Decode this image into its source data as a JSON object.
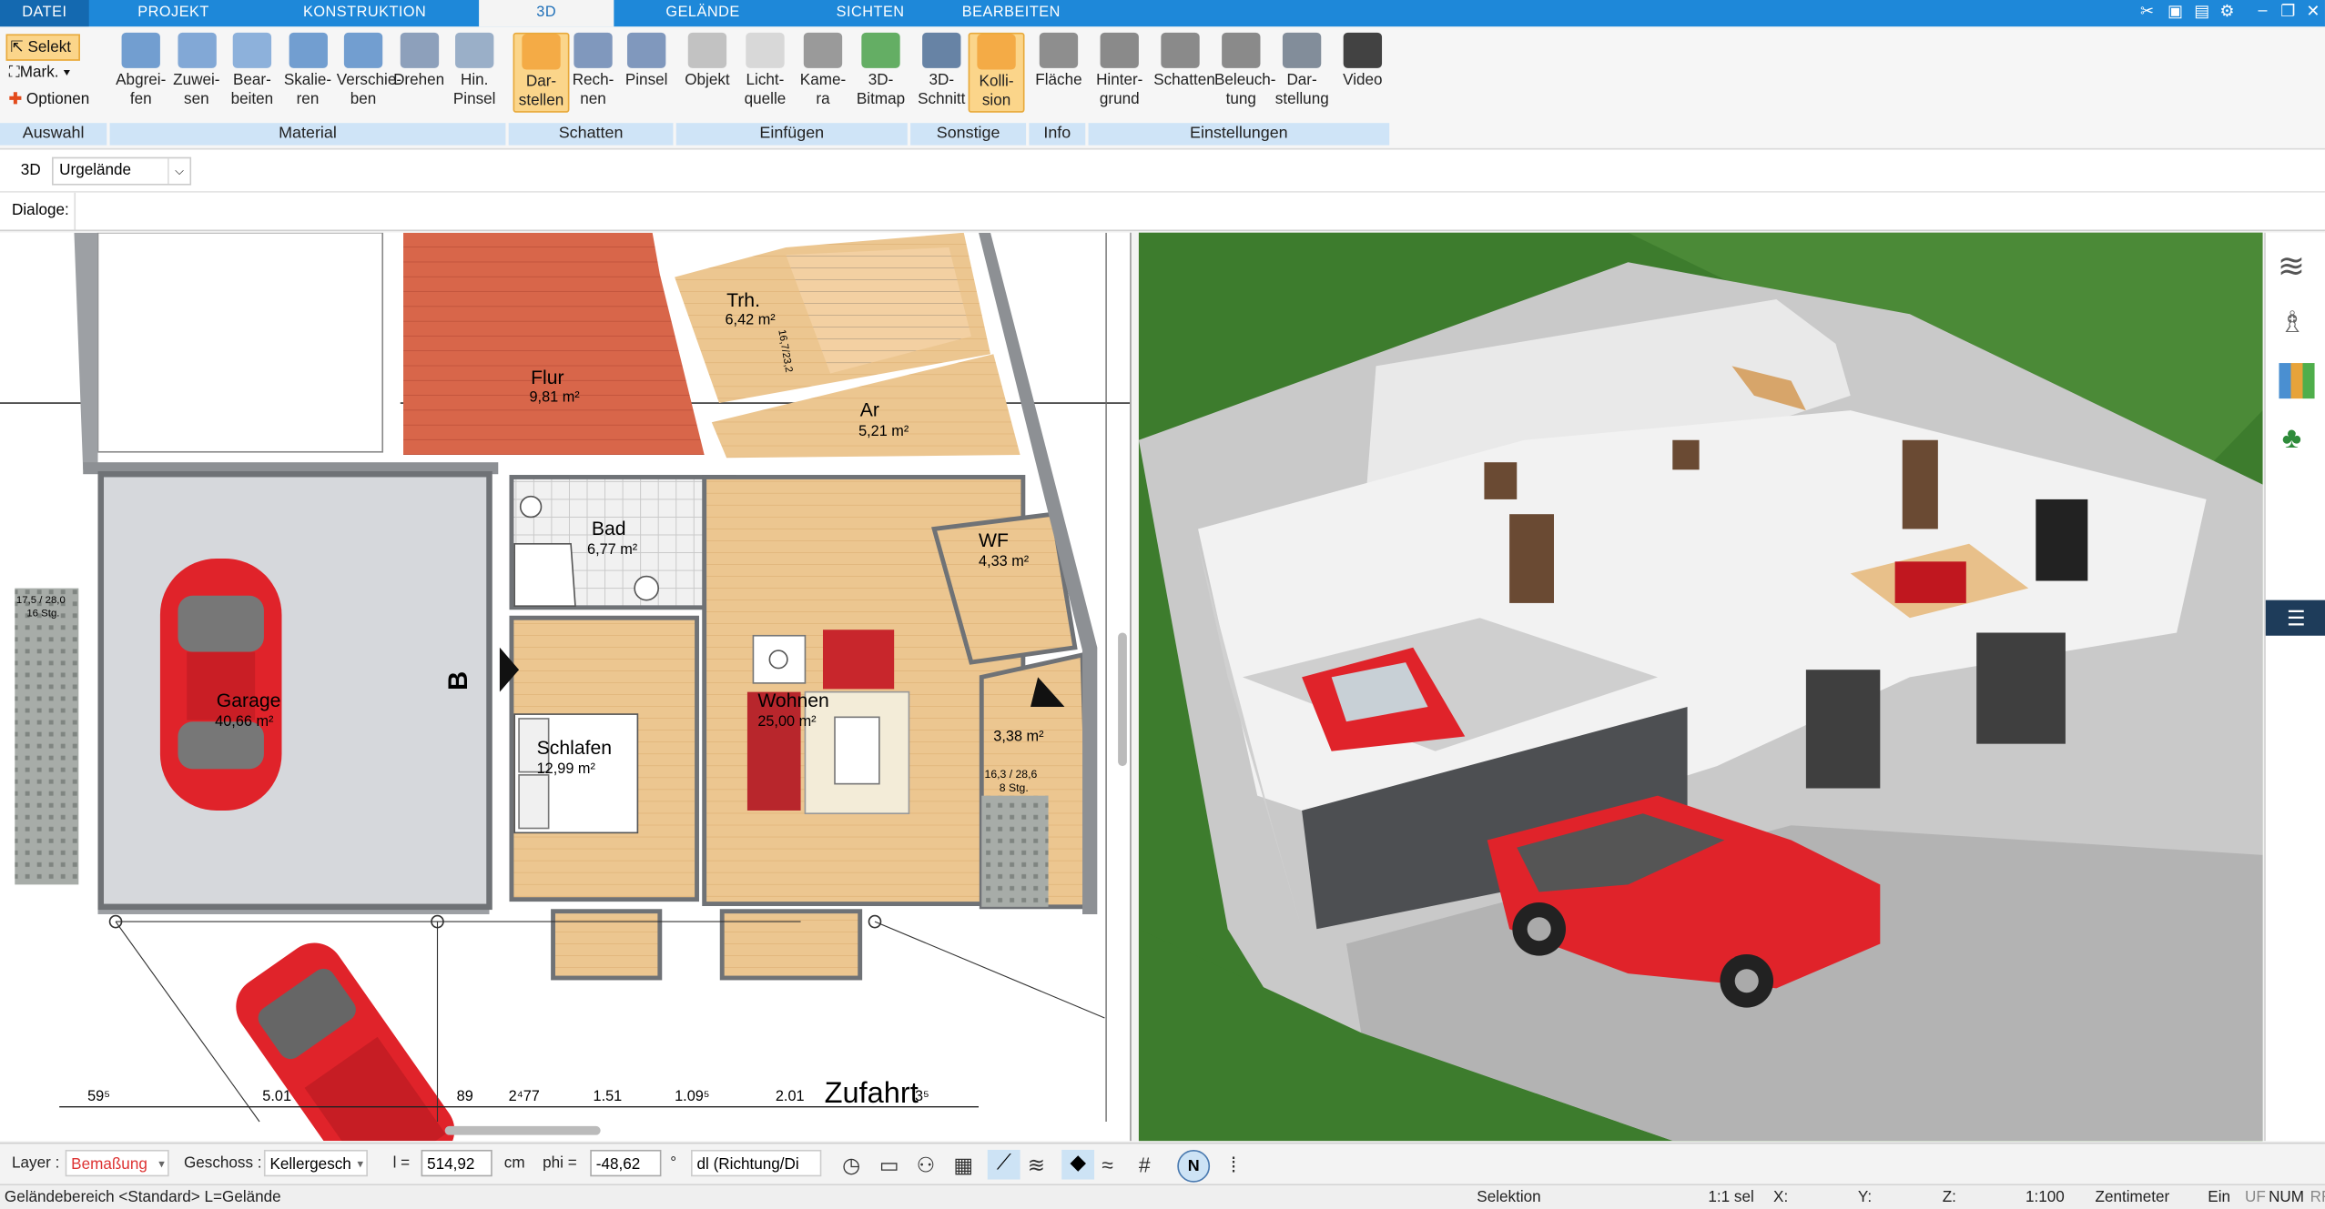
{
  "menu": {
    "tabs": [
      "DATEI",
      "PROJEKT",
      "KONSTRUKTION",
      "3D",
      "GELÄNDE",
      "SICHTEN",
      "BEARBEITEN"
    ],
    "active": "3D"
  },
  "ribbon": {
    "auswahl": {
      "selekt": "Selekt",
      "mark": "Mark.",
      "optionen": "Optionen",
      "label": "Auswahl"
    },
    "material": {
      "label": "Material",
      "buttons": [
        [
          "Abgrei-",
          "fen"
        ],
        [
          "Zuwei-",
          "sen"
        ],
        [
          "Bear-",
          "beiten"
        ],
        [
          "Skalie-",
          "ren"
        ],
        [
          "Verschie-",
          "ben"
        ],
        [
          "Drehen",
          ""
        ],
        [
          "Hin.",
          "Pinsel"
        ]
      ]
    },
    "schatten": {
      "label": "Schatten",
      "buttons": [
        [
          "Dar-",
          "stellen"
        ],
        [
          "Rech-",
          "nen"
        ],
        [
          "Pinsel",
          ""
        ]
      ]
    },
    "einfuegen": {
      "label": "Einfügen",
      "buttons": [
        [
          "Objekt",
          ""
        ],
        [
          "Licht-",
          "quelle"
        ],
        [
          "Kame-",
          "ra"
        ],
        [
          "3D-",
          "Bitmap"
        ]
      ]
    },
    "sonstige": {
      "label": "Sonstige",
      "buttons": [
        [
          "3D-",
          "Schnitt"
        ],
        [
          "Kolli-",
          "sion"
        ]
      ]
    },
    "info": {
      "label": "Info",
      "buttons": [
        [
          "Fläche",
          ""
        ]
      ]
    },
    "einstellungen": {
      "label": "Einstellungen",
      "buttons": [
        [
          "Hinter-",
          "grund"
        ],
        [
          "Schatten",
          ""
        ],
        [
          "Beleuch-",
          "tung"
        ],
        [
          "Dar-",
          "stellung"
        ],
        [
          "Video",
          ""
        ]
      ]
    }
  },
  "toolrow": {
    "mode": "3D",
    "select_value": "Urgelände"
  },
  "dialogrow": {
    "label": "Dialoge:"
  },
  "plan": {
    "rooms": [
      {
        "name": "Trh.",
        "area": "6,42 m²"
      },
      {
        "name": "Flur",
        "area": "9,81 m²"
      },
      {
        "name": "Ar",
        "area": "5,21 m²"
      },
      {
        "name": "Bad",
        "area": "6,77 m²"
      },
      {
        "name": "WF",
        "area": "4,33 m²"
      },
      {
        "name": "Garage",
        "area": "40,66 m²"
      },
      {
        "name": "Wohnen",
        "area": "25,00 m²"
      },
      {
        "name": "Schlafen",
        "area": "12,99 m²"
      },
      {
        "name": "",
        "area": "3,38 m²"
      }
    ],
    "stair_note_1": "16,7/23,2",
    "stair_note_2": "16,3 / 28,6",
    "stair_note_3": "8 Stg.",
    "stair_note_4": "17,5 / 28,0",
    "stair_note_5": "16 Stg.",
    "section_label": "B",
    "street_label": "Zufahrt",
    "dims": [
      "59⁵",
      "5.01",
      "89",
      "2⁴77",
      "1.51",
      "1.09⁵",
      "2.01",
      "3⁵"
    ]
  },
  "bottombar": {
    "layer_label": "Layer :",
    "layer_value": "Bemaßung",
    "geschoss_label": "Geschoss :",
    "geschoss_value": "Kellergesch",
    "l_label": "l =",
    "l_value": "514,92",
    "l_unit": "cm",
    "phi_label": "phi =",
    "phi_value": "-48,62",
    "phi_unit": "°",
    "dl_value": "dl (Richtung/Di"
  },
  "status": {
    "left": "Geländebereich <Standard> L=Gelände",
    "mode": "Selektion",
    "sel": "1:1 sel",
    "x": "X:",
    "y": "Y:",
    "z": "Z:",
    "scale": "1:100",
    "unit": "Zentimeter",
    "ein": "Ein",
    "uf": "UF",
    "num": "NUM",
    "rf": "RF"
  },
  "colors": {
    "accent": "#1e88d9",
    "car": "#e0232a",
    "grass": "#3f7a2c",
    "floor_wood": "#e8c08a",
    "floor_red": "#d8664a"
  }
}
